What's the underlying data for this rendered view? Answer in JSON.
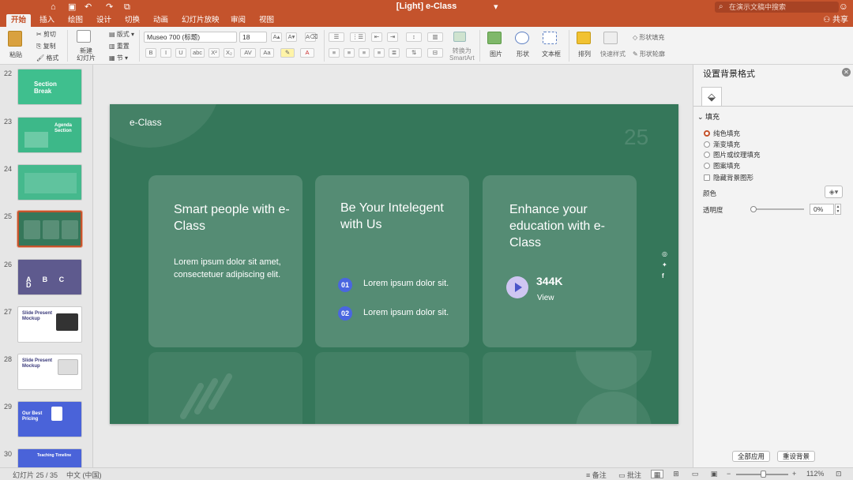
{
  "titlebar": {
    "title": "[Light] e-Class",
    "search_placeholder": "在演示文稿中搜索",
    "qa_home": "⌂",
    "qa_save": "▣",
    "qa_undo": "↶",
    "qa_redo": "↷",
    "qa_present": "⧉",
    "qa_more": "▾"
  },
  "tabs": {
    "items": [
      "开始",
      "插入",
      "绘图",
      "设计",
      "切换",
      "动画",
      "幻灯片放映",
      "审阅",
      "视图"
    ],
    "active": "开始",
    "share": "共享"
  },
  "ribbon": {
    "paste": "粘贴",
    "cut": "剪切",
    "copy": "复制",
    "format": "格式",
    "new_slide": "新建\n幻灯片",
    "layout": "版式",
    "reset": "重置",
    "section": "节",
    "font_name": "Museo 700 (标题)",
    "font_size": "18",
    "convert_smartart": "转换为\nSmartArt",
    "picture": "图片",
    "shape": "形状",
    "textbox": "文本框",
    "arrange": "排列",
    "quick_styles": "快速样式",
    "shape_fill": "形状填充",
    "shape_outline": "形状轮廓"
  },
  "thumbnails": [
    {
      "num": "22",
      "title": "Section\nBreak",
      "bg": "#3fbf8e",
      "fg": "#ffffff"
    },
    {
      "num": "23",
      "title": "Agenda\nSection",
      "bg": "#3db889",
      "fg": "#ffffff"
    },
    {
      "num": "24",
      "title": "",
      "bg": "#45b98d",
      "fg": "#ffffff"
    },
    {
      "num": "25",
      "title": "",
      "bg": "#35775a",
      "fg": "#ffffff"
    },
    {
      "num": "26",
      "title": "A B C D",
      "bg": "#5e5a8e",
      "fg": "#ffffff"
    },
    {
      "num": "27",
      "title": "Slide Present\nMockup",
      "bg": "#ffffff",
      "fg": "#3a3a7a"
    },
    {
      "num": "28",
      "title": "Slide Present\nMockup",
      "bg": "#ffffff",
      "fg": "#3a3a7a"
    },
    {
      "num": "29",
      "title": "Our Best\nPricing",
      "bg": "#4a63d9",
      "fg": "#ffffff"
    },
    {
      "num": "30",
      "title": "Teaching Timeline",
      "bg": "#4a63d9",
      "fg": "#ffffff"
    }
  ],
  "slide": {
    "brand": "e-Class",
    "page_number": "25",
    "card1": {
      "title": "Smart people with e-Class",
      "body": "Lorem ipsum dolor sit amet, consectetuer adipiscing elit."
    },
    "card2": {
      "title": "Be Your Intelegent with Us",
      "item1_num": "01",
      "item1_text": "Lorem ipsum dolor sit.",
      "item2_num": "02",
      "item2_text": "Lorem ipsum dolor sit."
    },
    "card3": {
      "title": "Enhance your education with e-Class",
      "stat": "344K",
      "stat_label": "View"
    },
    "social": [
      "instagram-icon",
      "twitter-icon",
      "facebook-icon"
    ]
  },
  "format_pane": {
    "title": "设置背景格式",
    "section": "填充",
    "options": [
      "纯色填充",
      "渐变填充",
      "图片或纹理填充",
      "图案填充"
    ],
    "selected": "纯色填充",
    "hide_bg": "隐藏背景图形",
    "color_label": "颜色",
    "transparency_label": "透明度",
    "transparency_value": "0%",
    "apply_all": "全部应用",
    "reset_bg": "重设背景"
  },
  "status": {
    "slide_info": "幻灯片 25 / 35",
    "language": "中文 (中国)",
    "notes": "备注",
    "comments": "批注",
    "zoom": "112%"
  }
}
